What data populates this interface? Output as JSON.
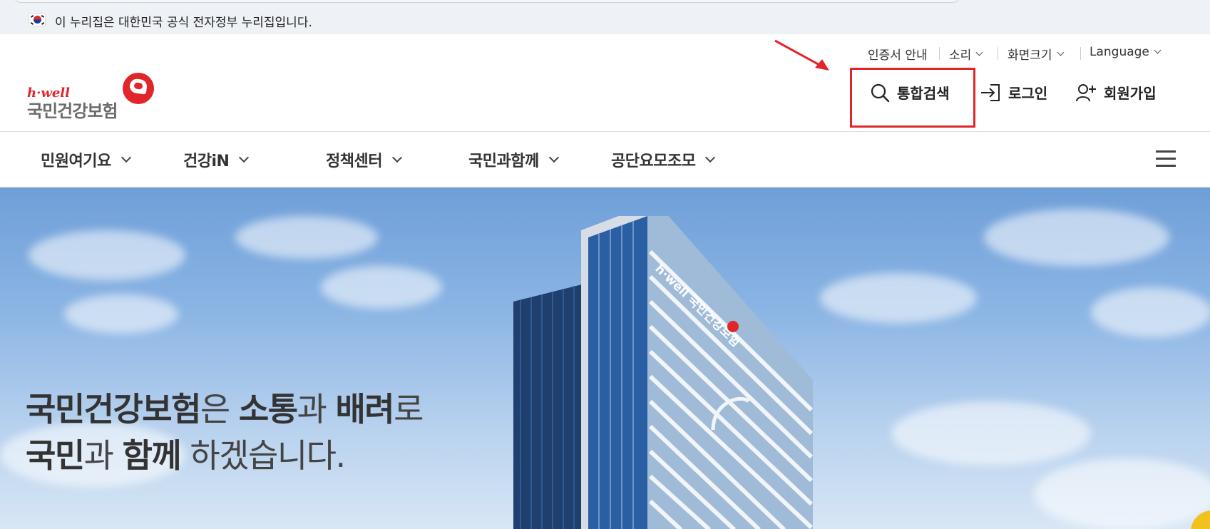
{
  "gov_banner": {
    "text": "이 누리집은 대한민국 공식 전자정부 누리집입니다."
  },
  "utility_menu": {
    "cert": "인증서 안내",
    "sound": "소리",
    "font_size": "화면크기",
    "language": "Language"
  },
  "logo": {
    "brand": "h·well",
    "name": "국민건강보험"
  },
  "header_actions": {
    "search": "통합검색",
    "login": "로그인",
    "signup": "회원가입"
  },
  "nav": {
    "items": [
      {
        "label": "민원여기요"
      },
      {
        "label": "건강iN"
      },
      {
        "label": "정책센터"
      },
      {
        "label": "국민과함께"
      },
      {
        "label": "공단요모조모"
      }
    ]
  },
  "hero": {
    "line1": {
      "a": "국민건강보험",
      "b": "은 ",
      "c": "소통",
      "d": "과 ",
      "e": "배려",
      "f": "로"
    },
    "line2": {
      "a": "국민",
      "b": "과 ",
      "c": "함께",
      "d": " 하겠습니다."
    },
    "building_sign": "h·well 국민건강보험"
  },
  "colors": {
    "accent": "#e0262b",
    "nav_text": "#333333",
    "banner_bg": "#eef1f5"
  }
}
